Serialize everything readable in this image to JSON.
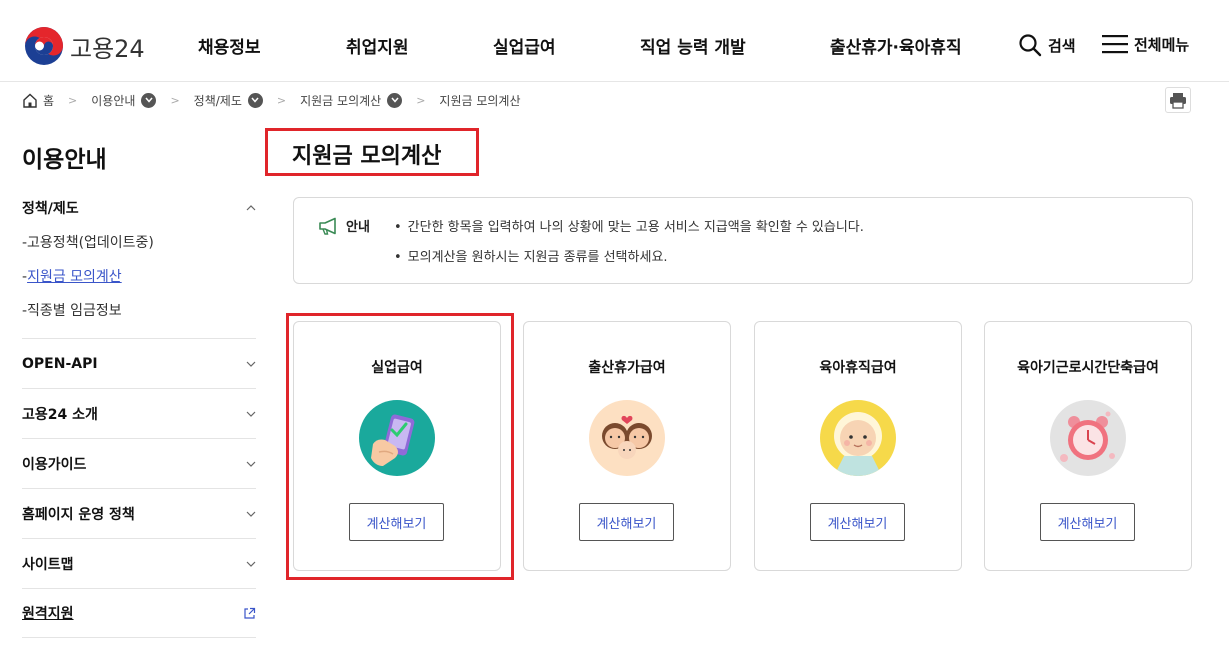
{
  "header": {
    "logo_text": "고용24",
    "nav": [
      "채용정보",
      "취업지원",
      "실업급여",
      "직업 능력 개발",
      "출산휴가·육아휴직"
    ],
    "search_label": "검색",
    "menu_label": "전체메뉴"
  },
  "breadcrumb": {
    "home": "홈",
    "items": [
      "이용안내",
      "정책/제도",
      "지원금 모의계산"
    ],
    "current": "지원금 모의계산"
  },
  "sidebar": {
    "title": "이용안내",
    "group": {
      "label": "정책/제도",
      "items": [
        "-고용정책(업데이트중)",
        "지원금 모의계산",
        "-직종별 임금정보"
      ],
      "active_prefix": "-"
    },
    "items": [
      "OPEN-API",
      "고용24 소개",
      "이용가이드",
      "홈페이지 운영 정책",
      "사이트맵",
      "원격지원"
    ]
  },
  "main": {
    "title": "지원금 모의계산",
    "notice": {
      "label": "안내",
      "lines": [
        "간단한 항목을 입력하여 나의 상황에 맞는 고용 서비스 지급액을 확인할 수 있습니다.",
        "모의계산을 원하시는 지원금 종류를 선택하세요."
      ]
    },
    "cards": [
      {
        "title": "실업급여",
        "button": "계산해보기",
        "icon": "phone-hand-icon",
        "bg": "#1aa99c"
      },
      {
        "title": "출산휴가급여",
        "button": "계산해보기",
        "icon": "family-icon",
        "bg": "#fde0c2"
      },
      {
        "title": "육아휴직급여",
        "button": "계산해보기",
        "icon": "baby-icon",
        "bg": "#f6d94a"
      },
      {
        "title": "육아기근로시간단축급여",
        "button": "계산해보기",
        "icon": "alarm-clock-icon",
        "bg": "#e3e3e3"
      }
    ]
  },
  "colors": {
    "accent": "#3a55c9",
    "highlight": "#e0252a"
  }
}
